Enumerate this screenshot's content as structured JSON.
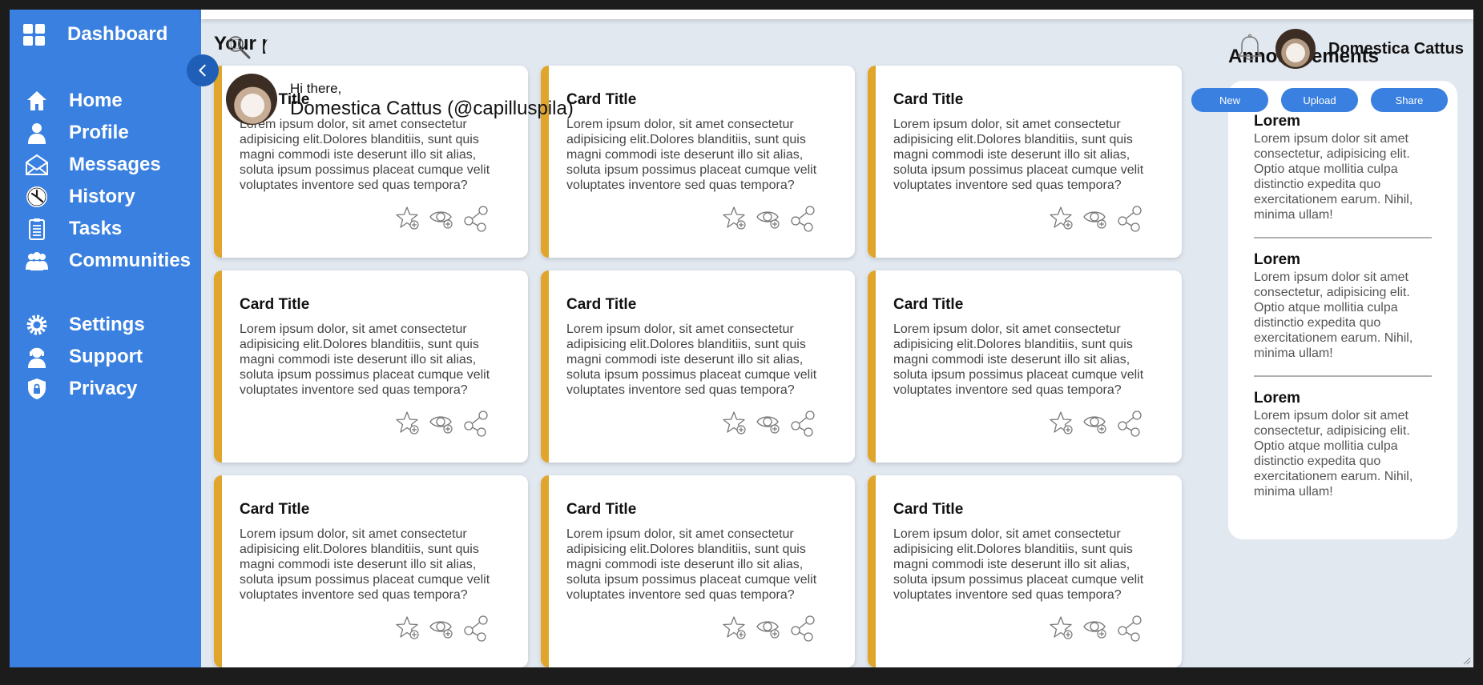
{
  "sidebar": {
    "brand_label": "Dashboard",
    "brand_icon": "dashboard-grid-icon",
    "primary_items": [
      {
        "label": "Home",
        "icon": "home-icon"
      },
      {
        "label": "Profile",
        "icon": "user-icon"
      },
      {
        "label": "Messages",
        "icon": "envelope-icon"
      },
      {
        "label": "History",
        "icon": "clock-icon"
      },
      {
        "label": "Tasks",
        "icon": "clipboard-icon"
      },
      {
        "label": "Communities",
        "icon": "group-icon"
      }
    ],
    "secondary_items": [
      {
        "label": "Settings",
        "icon": "gear-icon"
      },
      {
        "label": "Support",
        "icon": "headset-icon"
      },
      {
        "label": "Privacy",
        "icon": "shield-lock-icon"
      }
    ],
    "collapse_icon": "chevron-left-icon"
  },
  "header": {
    "search_placeholder": "",
    "search_value": "",
    "username": "Domestica Cattus",
    "greeting_small": "Hi there,",
    "greeting_name": "Domestica Cattus (@capilluspila)",
    "buttons": {
      "new": "New",
      "upload": "Upload",
      "share": "Share"
    }
  },
  "projects": {
    "title": "Your projects",
    "cards": [
      {
        "title": "Card Title",
        "body": "Lorem ipsum dolor, sit amet consectetur adipisicing elit.Dolores blanditiis, sunt quis magni commodi iste deserunt illo sit alias, soluta ipsum possimus placeat cumque velit voluptates inventore sed quas tempora?"
      },
      {
        "title": "Card Title",
        "body": "Lorem ipsum dolor, sit amet consectetur adipisicing elit.Dolores blanditiis, sunt quis magni commodi iste deserunt illo sit alias, soluta ipsum possimus placeat cumque velit voluptates inventore sed quas tempora?"
      },
      {
        "title": "Card Title",
        "body": "Lorem ipsum dolor, sit amet consectetur adipisicing elit.Dolores blanditiis, sunt quis magni commodi iste deserunt illo sit alias, soluta ipsum possimus placeat cumque velit voluptates inventore sed quas tempora?"
      },
      {
        "title": "Card Title",
        "body": "Lorem ipsum dolor, sit amet consectetur adipisicing elit.Dolores blanditiis, sunt quis magni commodi iste deserunt illo sit alias, soluta ipsum possimus placeat cumque velit voluptates inventore sed quas tempora?"
      },
      {
        "title": "Card Title",
        "body": "Lorem ipsum dolor, sit amet consectetur adipisicing elit.Dolores blanditiis, sunt quis magni commodi iste deserunt illo sit alias, soluta ipsum possimus placeat cumque velit voluptates inventore sed quas tempora?"
      },
      {
        "title": "Card Title",
        "body": "Lorem ipsum dolor, sit amet consectetur adipisicing elit.Dolores blanditiis, sunt quis magni commodi iste deserunt illo sit alias, soluta ipsum possimus placeat cumque velit voluptates inventore sed quas tempora?"
      },
      {
        "title": "Card Title",
        "body": "Lorem ipsum dolor, sit amet consectetur adipisicing elit.Dolores blanditiis, sunt quis magni commodi iste deserunt illo sit alias, soluta ipsum possimus placeat cumque velit voluptates inventore sed quas tempora?"
      },
      {
        "title": "Card Title",
        "body": "Lorem ipsum dolor, sit amet consectetur adipisicing elit.Dolores blanditiis, sunt quis magni commodi iste deserunt illo sit alias, soluta ipsum possimus placeat cumque velit voluptates inventore sed quas tempora?"
      },
      {
        "title": "Card Title",
        "body": "Lorem ipsum dolor, sit amet consectetur adipisicing elit.Dolores blanditiis, sunt quis magni commodi iste deserunt illo sit alias, soluta ipsum possimus placeat cumque velit voluptates inventore sed quas tempora?"
      }
    ],
    "card_icons": [
      "star-add-icon",
      "watch-add-icon",
      "share-icon"
    ]
  },
  "announcements": {
    "title": "Announcements",
    "items": [
      {
        "title": "Lorem",
        "body": "Lorem ipsum dolor sit amet consectetur, adipisicing elit. Optio atque mollitia culpa distinctio expedita quo exercitationem earum. Nihil, minima ullam!"
      },
      {
        "title": "Lorem",
        "body": "Lorem ipsum dolor sit amet consectetur, adipisicing elit. Optio atque mollitia culpa distinctio expedita quo exercitationem earum. Nihil, minima ullam!"
      },
      {
        "title": "Lorem",
        "body": "Lorem ipsum dolor sit amet consectetur, adipisicing elit. Optio atque mollitia culpa distinctio expedita quo exercitationem earum. Nihil, minima ullam!"
      }
    ]
  },
  "colors": {
    "sidebar": "#3a80e0",
    "accent": "#3a80e0",
    "card_border": "#e0a52a",
    "background": "#e2e8f0"
  }
}
